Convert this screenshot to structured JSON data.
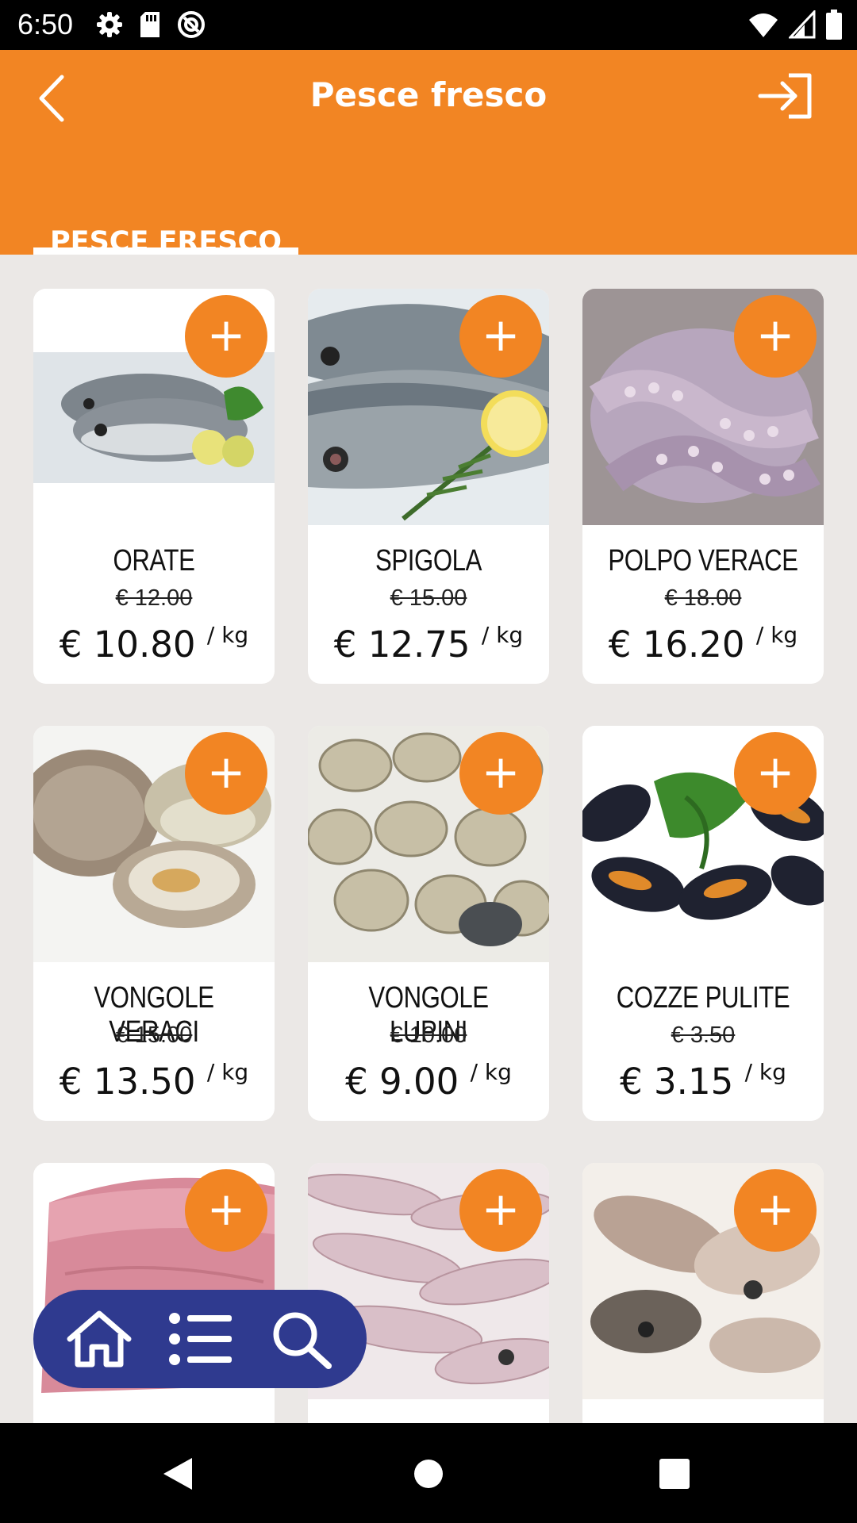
{
  "status_bar": {
    "time": "6:50",
    "left_icons": [
      "settings-icon",
      "sd-card-icon",
      "sync-icon"
    ],
    "right_icons": [
      "wifi-icon",
      "signal-icon",
      "battery-icon"
    ]
  },
  "header": {
    "title": "Pesce fresco",
    "back_icon": "chevron-left-icon",
    "logout_icon": "logout-icon",
    "tabs": [
      {
        "label": "PESCE FRESCO",
        "active": true
      }
    ]
  },
  "colors": {
    "accent": "#f28523",
    "nav": "#2f3a8f",
    "background": "#ebe8e6"
  },
  "products": [
    {
      "name": "ORATE",
      "old_price": "€ 12.00",
      "price": "€ 10.80",
      "unit": "/ kg",
      "add": "+"
    },
    {
      "name": "SPIGOLA",
      "old_price": "€ 15.00",
      "price": "€ 12.75",
      "unit": "/ kg",
      "add": "+"
    },
    {
      "name": "POLPO VERACE",
      "old_price": "€ 18.00",
      "price": "€ 16.20",
      "unit": "/ kg",
      "add": "+"
    },
    {
      "name": "VONGOLE VERACI",
      "old_price": "€ 15.00",
      "price": "€ 13.50",
      "unit": "/ kg",
      "add": "+"
    },
    {
      "name": "VONGOLE LUPINI",
      "old_price": "€ 10.00",
      "price": "€ 9.00",
      "unit": "/ kg",
      "add": "+"
    },
    {
      "name": "COZZE PULITE",
      "old_price": "€ 3.50",
      "price": "€ 3.15",
      "unit": "/ kg",
      "add": "+"
    },
    {
      "name": "",
      "old_price": "",
      "price": "",
      "unit": "",
      "add": "+"
    },
    {
      "name": "",
      "old_price": "",
      "price": "",
      "unit": "",
      "add": "+"
    },
    {
      "name": "",
      "old_price": "",
      "price": "",
      "unit": "",
      "add": "+"
    }
  ],
  "floating_nav": {
    "items": [
      "home-icon",
      "list-icon",
      "search-icon"
    ]
  },
  "system_nav": {
    "items": [
      "back-icon",
      "home-circle-icon",
      "recents-icon"
    ]
  }
}
